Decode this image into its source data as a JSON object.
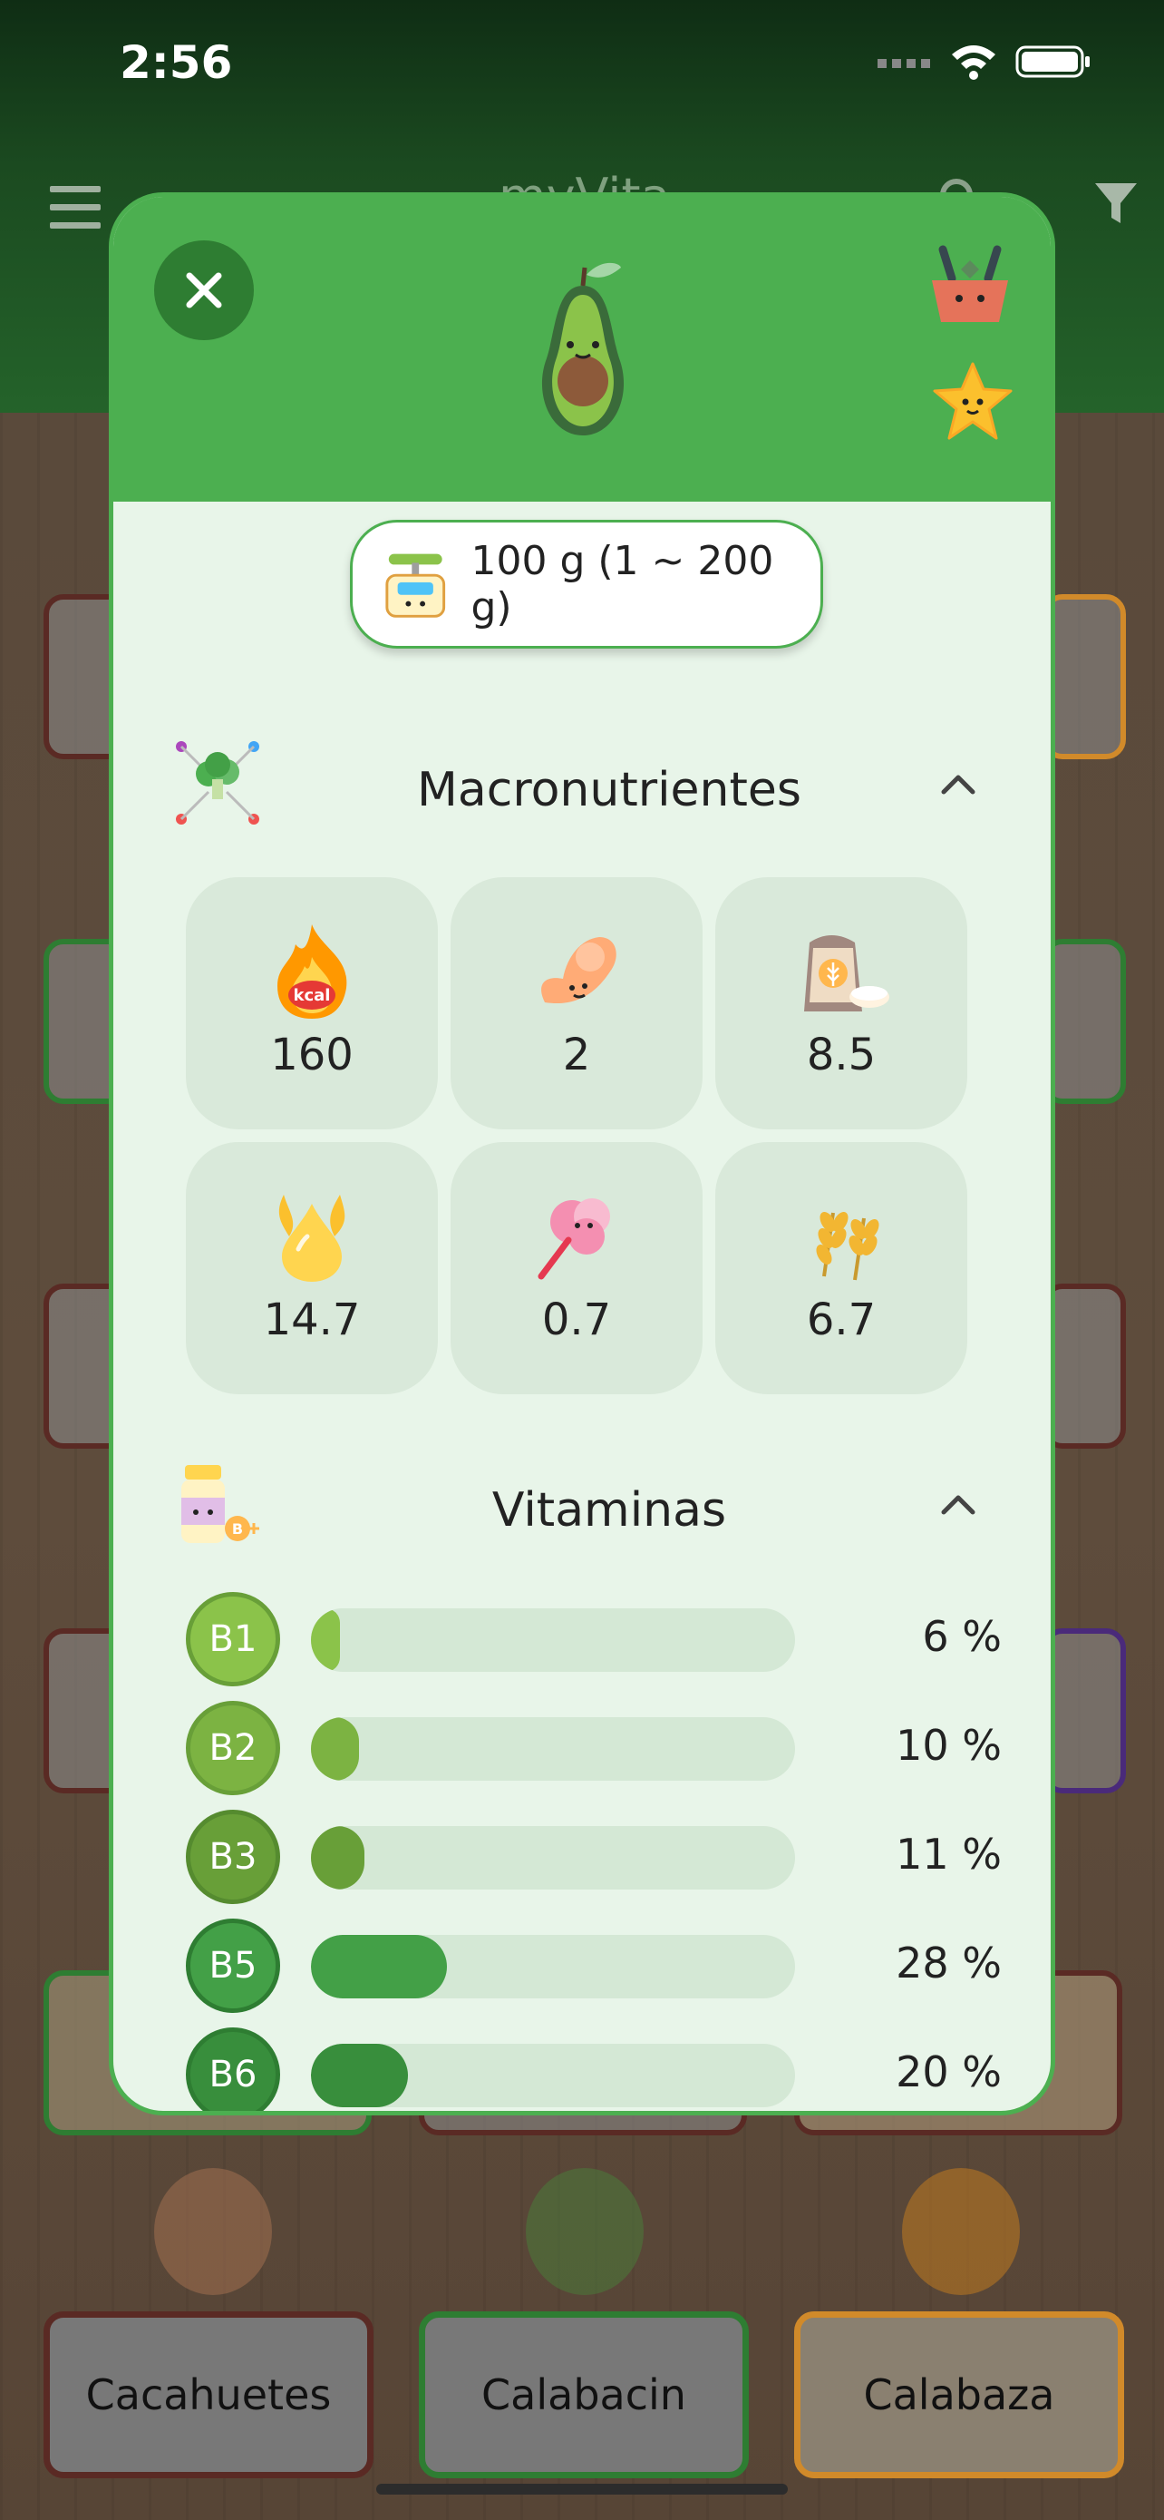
{
  "status": {
    "time": "2:56"
  },
  "app": {
    "title": "myVita"
  },
  "bottom_cards": [
    {
      "label": "Cacahuetes",
      "border": "#5a2a24"
    },
    {
      "label": "Calabacin",
      "border": "#2e7d32"
    },
    {
      "label": "Calabaza",
      "border": "#d18a2a"
    }
  ],
  "modal": {
    "weight": "100 g (1 ~ 200 g)",
    "macros": {
      "title": "Macronutrientes",
      "items": [
        {
          "icon": "kcal-fire-icon",
          "value": "160",
          "badge": "kcal"
        },
        {
          "icon": "protein-muscle-icon",
          "value": "2"
        },
        {
          "icon": "flour-sack-icon",
          "value": "8.5"
        },
        {
          "icon": "fat-drop-icon",
          "value": "14.7"
        },
        {
          "icon": "cotton-candy-sugar-icon",
          "value": "0.7"
        },
        {
          "icon": "wheat-fiber-icon",
          "value": "6.7"
        }
      ]
    },
    "vitamins": {
      "title": "Vitaminas",
      "items": [
        {
          "label": "B1",
          "value": "6 %",
          "level": 6,
          "color": "#8bc34a",
          "border": "#689f38"
        },
        {
          "label": "B2",
          "value": "10 %",
          "level": 10,
          "color": "#7cb342",
          "border": "#689f38"
        },
        {
          "label": "B3",
          "value": "11 %",
          "level": 11,
          "color": "#689f38",
          "border": "#558b2f"
        },
        {
          "label": "B5",
          "value": "28 %",
          "level": 28,
          "color": "#43a047",
          "border": "#2e7d32"
        },
        {
          "label": "B6",
          "value": "20 %",
          "level": 20,
          "color": "#388e3c",
          "border": "#2e7d32"
        }
      ]
    }
  },
  "colors": {
    "modal_green": "#4caf50",
    "dark_green": "#2e7d32",
    "modal_bg": "#e8f5e9"
  }
}
